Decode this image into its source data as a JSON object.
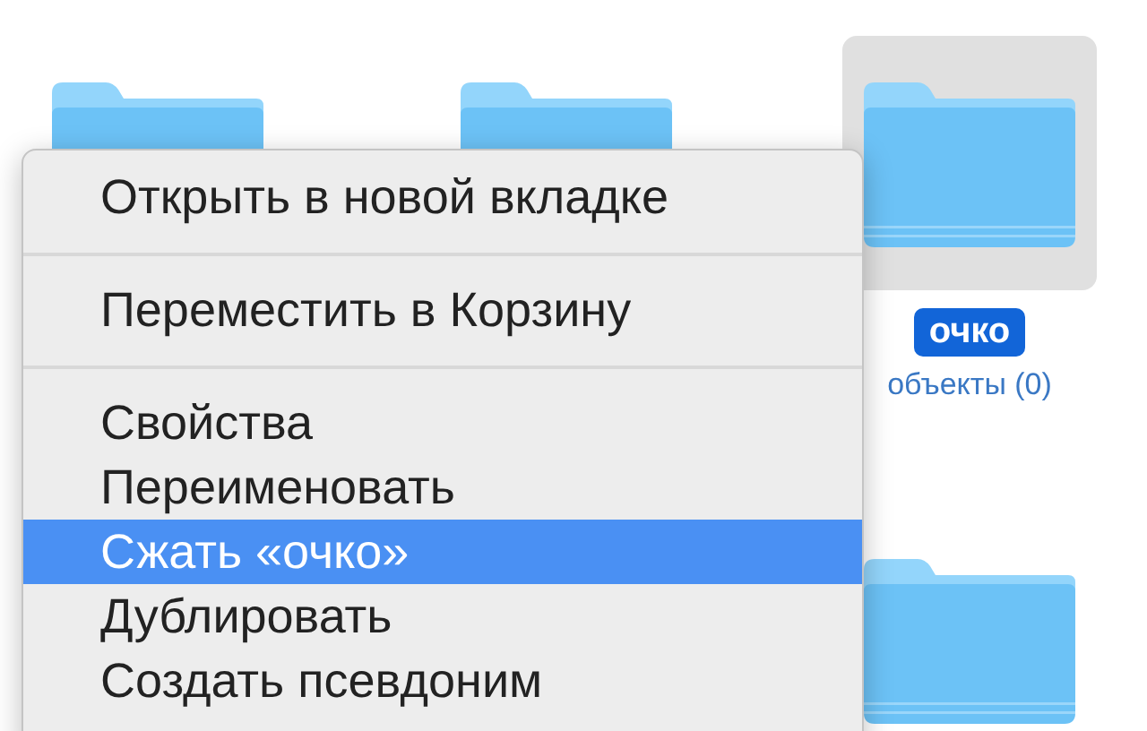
{
  "files": [
    {
      "selected": false
    },
    {
      "selected": false
    },
    {
      "name": "очко",
      "info": "объекты (0)",
      "selected": true
    },
    {
      "selected": false
    }
  ],
  "menu": {
    "items": [
      {
        "kind": "item",
        "label": "Открыть в новой вкладке",
        "selected": false
      },
      {
        "kind": "separator"
      },
      {
        "kind": "item",
        "label": "Переместить в Корзину",
        "selected": false
      },
      {
        "kind": "separator"
      },
      {
        "kind": "item",
        "label": "Свойства",
        "selected": false
      },
      {
        "kind": "item",
        "label": "Переименовать",
        "selected": false
      },
      {
        "kind": "item",
        "label": "Сжать «очко»",
        "selected": true
      },
      {
        "kind": "item",
        "label": "Дублировать",
        "selected": false
      },
      {
        "kind": "item",
        "label": "Создать псевдоним",
        "selected": false
      }
    ]
  }
}
